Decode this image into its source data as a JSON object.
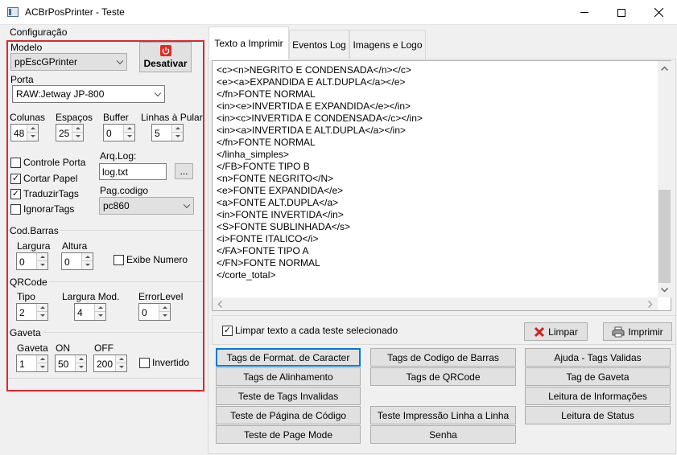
{
  "window": {
    "title": "ACBrPosPrinter - Teste"
  },
  "config": {
    "group_label": "Configuração",
    "modelo_label": "Modelo",
    "modelo_value": "ppEscGPrinter",
    "desativar_label": "Desativar",
    "porta_label": "Porta",
    "porta_value": "RAW:Jetway JP-800",
    "colunas_label": "Colunas",
    "colunas_value": "48",
    "espacos_label": "Espaços",
    "espacos_value": "25",
    "buffer_label": "Buffer",
    "buffer_value": "0",
    "linhas_label": "Linhas à Pular",
    "linhas_value": "5",
    "controle_porta_label": "Controle Porta",
    "cortar_papel_label": "Cortar Papel",
    "traduzir_tags_label": "TraduzirTags",
    "ignorar_tags_label": "IgnorarTags",
    "arqlog_label": "Arq.Log:",
    "arqlog_value": "log.txt",
    "browse_label": "...",
    "pagcodigo_label": "Pag.codigo",
    "pagcodigo_value": "pc860"
  },
  "codbarras": {
    "group_label": "Cod.Barras",
    "largura_label": "Largura",
    "largura_value": "0",
    "altura_label": "Altura",
    "altura_value": "0",
    "exibe_numero_label": "Exibe Numero"
  },
  "qrcode": {
    "group_label": "QRCode",
    "tipo_label": "Tipo",
    "tipo_value": "2",
    "largura_mod_label": "Largura Mod.",
    "largura_mod_value": "4",
    "errorlevel_label": "ErrorLevel",
    "errorlevel_value": "0"
  },
  "gaveta": {
    "group_label": "Gaveta",
    "gaveta_label": "Gaveta",
    "gaveta_value": "1",
    "on_label": "ON",
    "on_value": "50",
    "off_label": "OFF",
    "off_value": "200",
    "invertido_label": "Invertido"
  },
  "tabs": [
    "Texto a Imprimir",
    "Eventos Log",
    "Imagens e Logo"
  ],
  "memo_lines": [
    "<c><n>NEGRITO E CONDENSADA</n></c>",
    "<e><a>EXPANDIDA E ALT.DUPLA</a></e>",
    "</fn>FONTE NORMAL",
    "<in><e>INVERTIDA E EXPANDIDA</e></in>",
    "<in><c>INVERTIDA E CONDENSADA</c></in>",
    "<in><a>INVERTIDA E ALT.DUPLA</a></in>",
    "</fn>FONTE NORMAL",
    "</linha_simples>",
    "</FB>FONTE TIPO B",
    "<n>FONTE NEGRITO</N>",
    "<e>FONTE EXPANDIDA</e>",
    "<a>FONTE ALT.DUPLA</a>",
    "<in>FONTE INVERTIDA</in>",
    "<S>FONTE SUBLINHADA</s>",
    "<i>FONTE ITALICO</i>",
    "</FA>FONTE TIPO A",
    "</FN>FONTE NORMAL",
    "</corte_total>"
  ],
  "limpar_check_label": "Limpar texto a cada teste selecionado",
  "limpar_label": "Limpar",
  "imprimir_label": "Imprimir",
  "buttons": {
    "b1": "Tags de Format. de Caracter",
    "b2": "Tags de Codigo de Barras",
    "b3": "Ajuda - Tags Validas",
    "b4": "Tags de Alinhamento",
    "b5": "Tags de QRCode",
    "b6": "Tag de Gaveta",
    "b7": "Teste de Tags Invalidas",
    "b8": "Leitura de Informações",
    "b9": "Teste de Página de Código",
    "b10": "Teste Impressão Linha a Linha",
    "b11": "Leitura de Status",
    "b12": "Teste de Page Mode",
    "b13": "Senha"
  },
  "colors": {
    "highlight_border": "#e0262e",
    "focus_blue": "#0078d7",
    "power_red": "#e8281e"
  }
}
